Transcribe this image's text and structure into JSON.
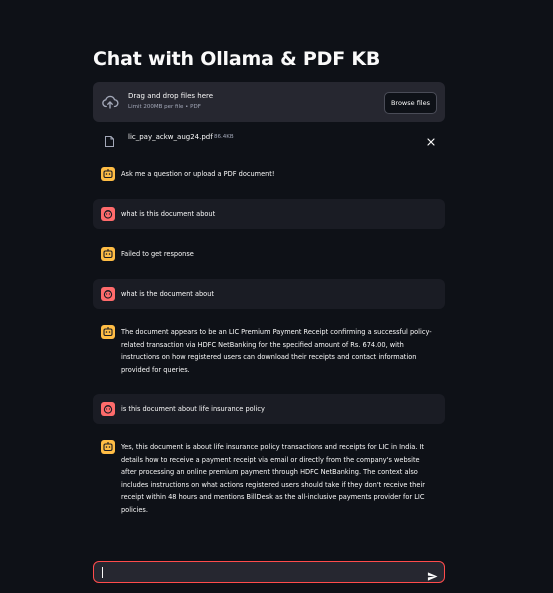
{
  "title": "Chat with Ollama & PDF KB",
  "uploader": {
    "dropzone_title": "Drag and drop files here",
    "dropzone_limits": "Limit 200MB per file • PDF",
    "browse_label": "Browse files",
    "file": {
      "name": "lic_pay_ackw_aug24.pdf",
      "size": "86.4KB"
    }
  },
  "messages": [
    {
      "role": "assistant",
      "text": "Ask me a question or upload a PDF document!"
    },
    {
      "role": "user",
      "text": "what is this document about"
    },
    {
      "role": "assistant",
      "text": "Failed to get response"
    },
    {
      "role": "user",
      "text": "what is the document about"
    },
    {
      "role": "assistant",
      "text": "The document appears to be an LIC Premium Payment Receipt confirming a successful policy-related transaction via HDFC NetBanking for the specified amount of Rs. 674.00, with instructions on how registered users can download their receipts and contact information provided for queries."
    },
    {
      "role": "user",
      "text": "is this document about life insurance policy"
    },
    {
      "role": "assistant",
      "text": "Yes, this document is about life insurance policy transactions and receipts for LIC in India. It details how to receive a payment receipt via email or directly from the company's website after processing an online premium payment through HDFC NetBanking. The context also includes instructions on what actions registered users should take if they don't receive their receipt within 48 hours and mentions BillDesk as the all-inclusive payments provider for LIC policies."
    }
  ],
  "chat_input": {
    "value": "",
    "placeholder": ""
  },
  "colors": {
    "background": "#0e1117",
    "panel": "#262730",
    "user_message_bg": "#1a1c24",
    "user_avatar": "#ff6b6b",
    "assistant_avatar": "#ffbd45",
    "input_border_focus": "#ff4b4b"
  },
  "icons": {
    "upload": "cloud-upload-icon",
    "file": "file-icon",
    "remove": "close-icon",
    "user_avatar": "user-face-icon",
    "assistant_avatar": "bot-face-icon",
    "send": "send-icon"
  }
}
